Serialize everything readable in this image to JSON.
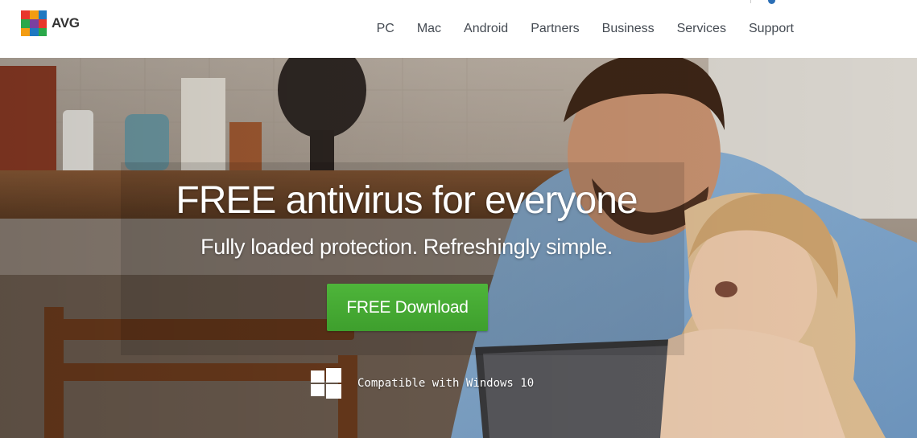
{
  "header": {
    "logo_text": "AVG",
    "nav": [
      "PC",
      "Mac",
      "Android",
      "Partners",
      "Business",
      "Services",
      "Support"
    ]
  },
  "hero": {
    "title": "FREE antivirus for everyone",
    "subtitle": "Fully loaded protection. Refreshingly simple.",
    "download_label": "FREE Download",
    "compat_text": "Compatible with Windows 10",
    "compat_icon": "windows-logo-icon"
  },
  "colors": {
    "button_green": "#43a832",
    "nav_text": "#444a52",
    "hero_text": "#ffffff"
  }
}
